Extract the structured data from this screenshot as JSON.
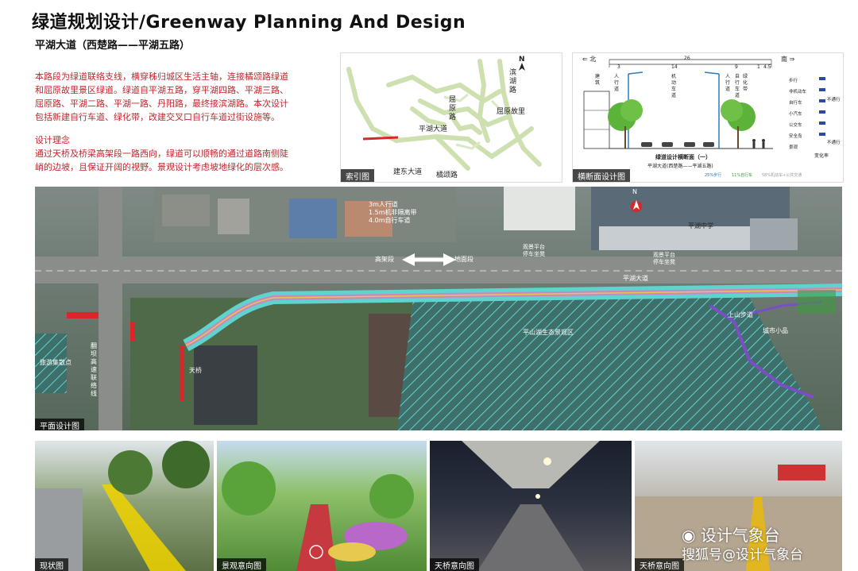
{
  "header": {
    "title": "绿道规划设计/Greenway Planning And Design",
    "subtitle": "平湖大道（西楚路——平湖五路）"
  },
  "intro": {
    "lines": [
      "本路段为绿道联络支线，横穿秭归城区生活主轴，连接橘颂路绿道",
      "和屈原故里景区绿道。绿道自平湖五路，穿平湖四路、平湖三路、",
      "屈原路、平湖二路、平湖一路、丹阳路，最终接滨湖路。本次设计",
      "包括新建自行车道、绿化带，改建交叉口自行车道过街设施等。"
    ]
  },
  "concept": {
    "heading": "设计理念",
    "lines": [
      "通过天桥及桥梁高架段一路西向，绿道可以顺畅的通过道路南侧陡",
      "峭的边坡，且保证开阔的视野。景观设计考虑坡地绿化的层次感。"
    ]
  },
  "index_map": {
    "caption": "索引图",
    "labels": {
      "binhu": "滨湖路",
      "quyuan_road": "屈原路",
      "quyuan_hometown": "屈原故里",
      "pinghu": "平湖大道",
      "jiandong": "建东大道",
      "jusong": "橘颂路"
    },
    "north": "N"
  },
  "cross_section": {
    "caption": "横断面设计图",
    "left_arrow": "北",
    "right_arrow": "南",
    "dims": [
      "26",
      "3",
      "14",
      "9",
      "1",
      "4.5"
    ],
    "cols": {
      "left": "建筑",
      "sidewalk": "人行道",
      "car": "机动车道",
      "sidewalk2": "人行道",
      "bike": "自行车道",
      "green": "绿化带"
    },
    "title": "绿道设计横断面（一）",
    "subtitle": "平湖大道(西楚路——平湖五路)",
    "scale_notes": [
      "25%步行",
      "11%自行车",
      "58%机动车+公共交通"
    ],
    "legend": {
      "items": [
        "步行",
        "非机动车",
        "自行车",
        "小汽车",
        "公交车",
        "安全岛",
        "景观"
      ],
      "no_pass": "不通行",
      "label": "变化率"
    }
  },
  "plan": {
    "caption": "平面设计图",
    "callout_lines": [
      "3m人行道",
      "1.5m机非隔离带",
      "4.0m自行车道"
    ],
    "level_left": "高架段",
    "level_right": "地面段",
    "platform1": [
      "观景平台",
      "停车坐凳"
    ],
    "platform2": [
      "观景平台",
      "停车坐凳"
    ],
    "road": "平湖大道",
    "school": "平湖中学",
    "park": "平山湖生态景观区",
    "path1": "上山步道",
    "path2": "城市小品",
    "bridge": "天桥",
    "west_label": "旅游集散点",
    "vertical_road": "翻坝高速联络线",
    "north": "N"
  },
  "photos": [
    {
      "caption": "现状图"
    },
    {
      "caption": "景观意向图"
    },
    {
      "caption": "天桥意向图"
    },
    {
      "caption": "天桥意向图"
    }
  ],
  "watermark": {
    "wechat": "设计气象台",
    "sohu": "搜狐号@设计气象台"
  },
  "colors": {
    "red_text": "#c0272d",
    "greenway_red": "#d9262b",
    "cyan_hatch": "#5fd4cf",
    "purple_path": "#7a4fc4"
  }
}
